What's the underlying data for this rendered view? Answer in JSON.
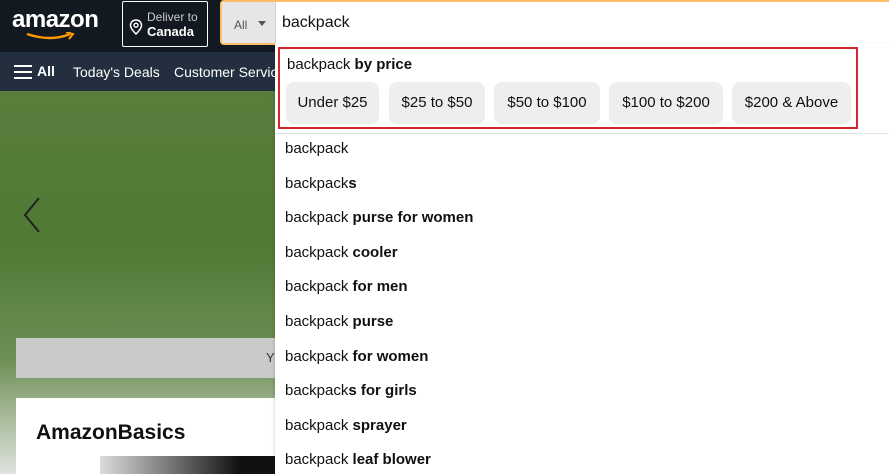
{
  "header": {
    "logo": "amazon",
    "deliver_line1": "Deliver to",
    "deliver_line2": "Canada",
    "search_category": "All",
    "search_value": "backpack"
  },
  "subnav": {
    "all": "All",
    "items": [
      "Today's Deals",
      "Customer Servic"
    ]
  },
  "background": {
    "notice_text": "Y",
    "card_title": "AmazonBasics"
  },
  "dropdown": {
    "price_title_prefix": "backpack",
    "price_title_suffix": "by price",
    "price_chips": [
      "Under $25",
      "$25 to $50",
      "$50 to $100",
      "$100 to $200",
      "$200 & Above"
    ],
    "suggestions": [
      {
        "prefix": "backpack",
        "suffix": ""
      },
      {
        "prefix": "backpack",
        "suffix": "s"
      },
      {
        "prefix": "backpack",
        "suffix": " purse for women"
      },
      {
        "prefix": "backpack",
        "suffix": " cooler"
      },
      {
        "prefix": "backpack",
        "suffix": " for men"
      },
      {
        "prefix": "backpack",
        "suffix": " purse"
      },
      {
        "prefix": "backpack",
        "suffix": " for women"
      },
      {
        "prefix": "backpack",
        "suffix": "s for girls"
      },
      {
        "prefix": "backpack",
        "suffix": " sprayer"
      },
      {
        "prefix": "backpack",
        "suffix": " leaf blower"
      }
    ]
  },
  "colors": {
    "nav_dark": "#131921",
    "subnav": "#232f3e",
    "search_border": "#febd69",
    "highlight_box": "#d8232a",
    "smile": "#ff9900"
  },
  "icons": [
    "location-pin-icon",
    "menu-icon",
    "chevron-left-icon",
    "caret-down-icon"
  ]
}
